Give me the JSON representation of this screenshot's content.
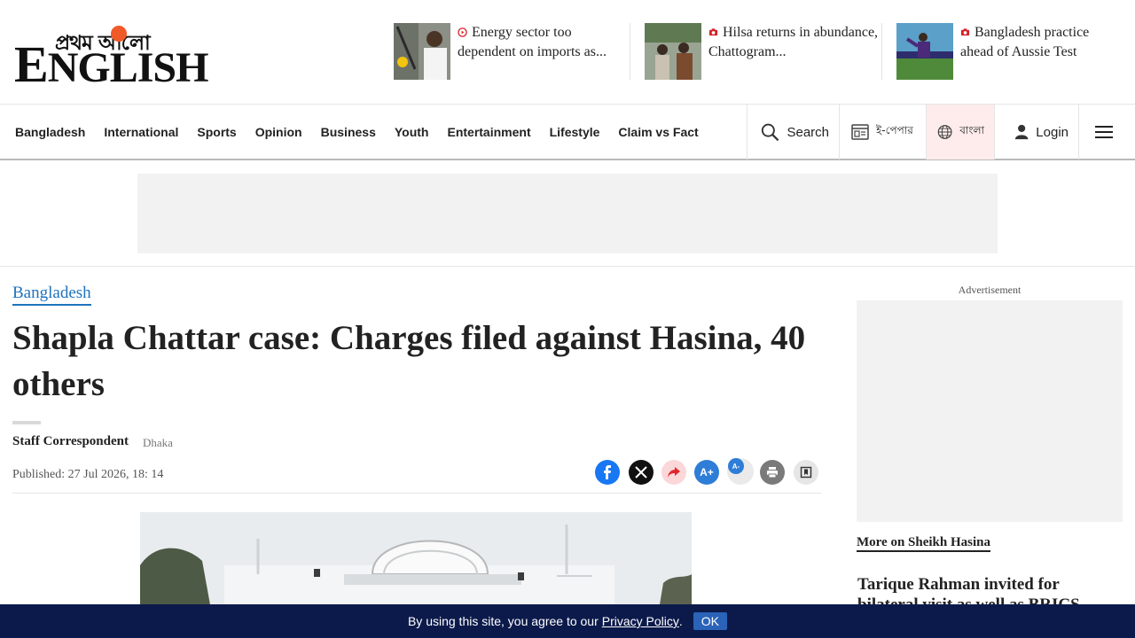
{
  "logo": {
    "bangla": "প্রথম আলো",
    "english_first": "E",
    "english_rest": "NGLISH"
  },
  "teasers": [
    {
      "text": "Energy sector too dependent on imports as...",
      "icon": "video-play-icon"
    },
    {
      "text": "Hilsa returns in abundance, Chattogram...",
      "icon": "camera-icon"
    },
    {
      "text": "Bangladesh practice ahead of Aussie Test",
      "icon": "camera-icon"
    }
  ],
  "nav": {
    "items": [
      "Bangladesh",
      "International",
      "Sports",
      "Opinion",
      "Business",
      "Youth",
      "Entertainment",
      "Lifestyle",
      "Claim vs Fact"
    ],
    "search": "Search",
    "epaper": "ই-পেপার",
    "bangla": "বাংলা",
    "login": "Login"
  },
  "article": {
    "category": "Bangladesh",
    "headline": "Shapla Chattar case: Charges filed against Hasina, 40 others",
    "author": "Staff Correspondent",
    "location": "Dhaka",
    "published": "Published: 27 Jul 2026, 18: 14",
    "share": {
      "facebook": "facebook-icon",
      "x": "x-icon",
      "share": "share-arrow-icon",
      "font_increase": "A+",
      "font_decrease": "A-",
      "print": "print-icon",
      "bookmark": "bookmark-icon"
    }
  },
  "sidebar": {
    "ad_label": "Advertisement",
    "more_on": "More on Sheikh Hasina",
    "story": "Tarique Rahman invited for bilateral visit as well as BRICS"
  },
  "cookie": {
    "text": "By using this site, you agree to our",
    "policy": "Privacy Policy",
    "period": ".",
    "ok": "OK"
  },
  "colors": {
    "accent": "#1e73be",
    "cookie_bg": "#0c1a4b",
    "logo_sun": "#f05a28",
    "facebook": "#1877f2"
  }
}
